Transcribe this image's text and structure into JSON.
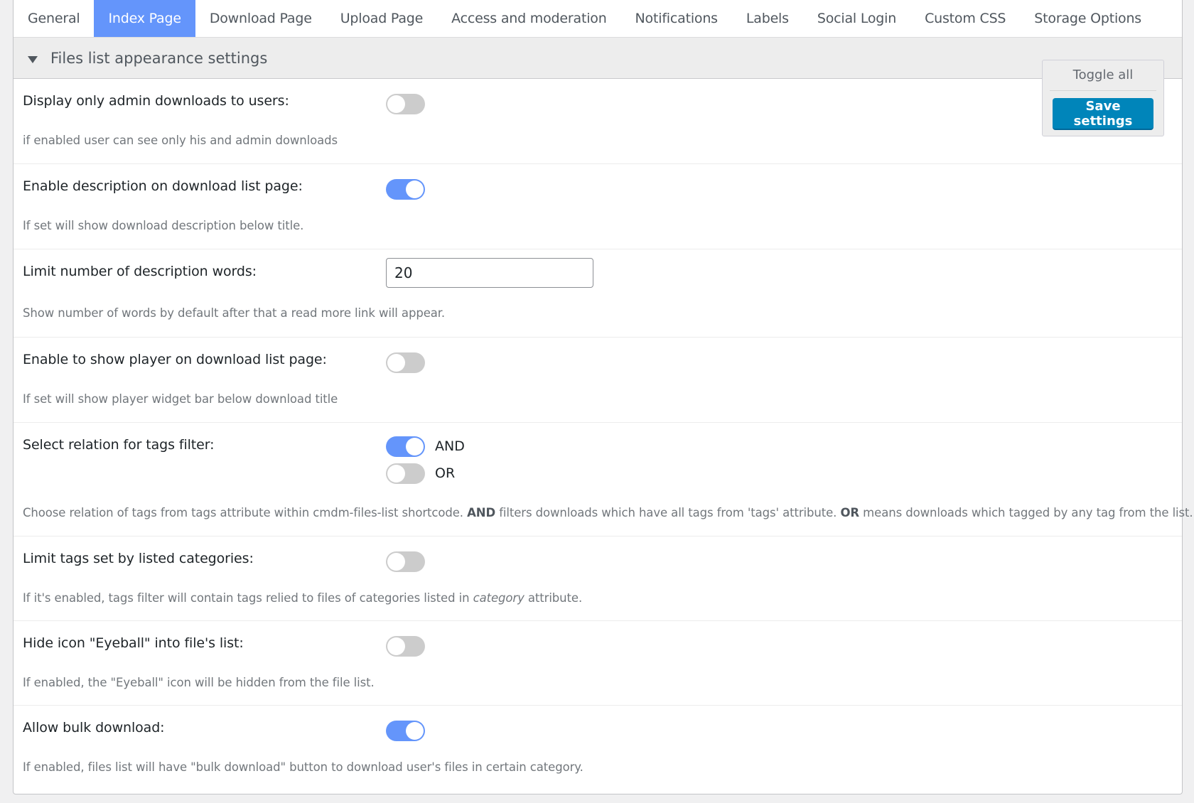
{
  "tabs": [
    {
      "label": "General",
      "active": false
    },
    {
      "label": "Index Page",
      "active": true
    },
    {
      "label": "Download Page",
      "active": false
    },
    {
      "label": "Upload Page",
      "active": false
    },
    {
      "label": "Access and moderation",
      "active": false
    },
    {
      "label": "Notifications",
      "active": false
    },
    {
      "label": "Labels",
      "active": false
    },
    {
      "label": "Social Login",
      "active": false
    },
    {
      "label": "Custom CSS",
      "active": false
    },
    {
      "label": "Storage Options",
      "active": false
    }
  ],
  "section": {
    "title": "Files list appearance settings",
    "expanded": true
  },
  "actions": {
    "toggle_all_label": "Toggle all",
    "save_label": "Save settings"
  },
  "colors": {
    "accent": "#6495fb",
    "save_button": "#0085ba",
    "toggle_off": "#cccccc"
  },
  "settings": {
    "display_admin_only": {
      "label": "Display only admin downloads to users:",
      "enabled": false,
      "help": "if enabled user can see only his and admin downloads"
    },
    "enable_description": {
      "label": "Enable description on download list page:",
      "enabled": true,
      "help": "If set will show download description below title."
    },
    "description_words": {
      "label": "Limit number of description words:",
      "value": "20",
      "help": "Show number of words by default after that a read more link will appear."
    },
    "show_player": {
      "label": "Enable to show player on download list page:",
      "enabled": false,
      "help": "If set will show player widget bar below download title"
    },
    "tags_relation": {
      "label": "Select relation for tags filter:",
      "options": [
        {
          "label": "AND",
          "selected": true
        },
        {
          "label": "OR",
          "selected": false
        }
      ],
      "help_parts": {
        "p1": "Choose relation of tags from tags attribute within cmdm-files-list shortcode. ",
        "and": "AND",
        "p2": " filters downloads which have all tags from 'tags' attribute. ",
        "or": "OR",
        "p3": " means downloads which tagged by any tag from the list."
      }
    },
    "limit_tags_by_categories": {
      "label": "Limit tags set by listed categories:",
      "enabled": false,
      "help_parts": {
        "p1": "If it's enabled, tags filter will contain tags relied to files of categories listed in ",
        "em": "category",
        "p2": " attribute."
      }
    },
    "hide_eyeball": {
      "label": "Hide icon \"Eyeball\" into file's list:",
      "enabled": false,
      "help": "If enabled, the \"Eyeball\" icon will be hidden from the file list."
    },
    "bulk_download": {
      "label": "Allow bulk download:",
      "enabled": true,
      "help": "If enabled, files list will have \"bulk download\" button to download user's files in certain category."
    }
  }
}
